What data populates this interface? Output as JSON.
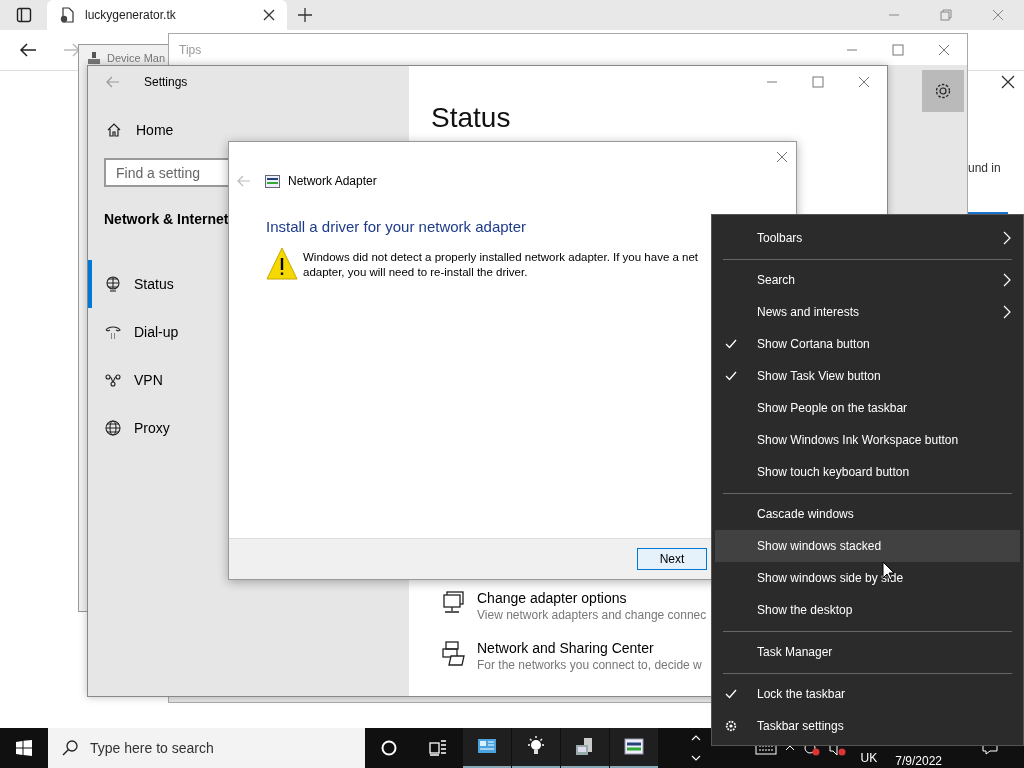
{
  "browser": {
    "tab_title": "luckygenerator.tk"
  },
  "device_manager": {
    "title": "Device Man"
  },
  "tips": {
    "title": "Tips"
  },
  "side_panel": {
    "text": "und in"
  },
  "settings": {
    "title": "Settings",
    "home": "Home",
    "search_placeholder": "Find a setting",
    "section": "Network & Internet",
    "nav": [
      {
        "label": "Status",
        "selected": true
      },
      {
        "label": "Dial-up",
        "selected": false
      },
      {
        "label": "VPN",
        "selected": false
      },
      {
        "label": "Proxy",
        "selected": false
      }
    ],
    "heading": "Status",
    "links": [
      {
        "title": "Change adapter options",
        "subtitle": "View network adapters and change connec"
      },
      {
        "title": "Network and Sharing Center",
        "subtitle": "For the networks you connect to, decide w"
      }
    ]
  },
  "dialog": {
    "title": "Network Adapter",
    "heading": "Install a driver for your network adapter",
    "message_lines": [
      "Windows did not detect a properly installed network adapter. If you have a net",
      "adapter, you will need to re-install the driver."
    ],
    "next_button": "Next"
  },
  "context_menu": {
    "items": [
      {
        "kind": "item",
        "label": "Toolbars",
        "submenu": true,
        "checked": false,
        "highlighted": false
      },
      {
        "kind": "separator"
      },
      {
        "kind": "item",
        "label": "Search",
        "submenu": true,
        "checked": false,
        "highlighted": false
      },
      {
        "kind": "item",
        "label": "News and interests",
        "submenu": true,
        "checked": false,
        "highlighted": false
      },
      {
        "kind": "item",
        "label": "Show Cortana button",
        "submenu": false,
        "checked": true,
        "highlighted": false
      },
      {
        "kind": "item",
        "label": "Show Task View button",
        "submenu": false,
        "checked": true,
        "highlighted": false
      },
      {
        "kind": "item",
        "label": "Show People on the taskbar",
        "submenu": false,
        "checked": false,
        "highlighted": false
      },
      {
        "kind": "item",
        "label": "Show Windows Ink Workspace button",
        "submenu": false,
        "checked": false,
        "highlighted": false
      },
      {
        "kind": "item",
        "label": "Show touch keyboard button",
        "submenu": false,
        "checked": false,
        "highlighted": false
      },
      {
        "kind": "separator"
      },
      {
        "kind": "item",
        "label": "Cascade windows",
        "submenu": false,
        "checked": false,
        "highlighted": false
      },
      {
        "kind": "item",
        "label": "Show windows stacked",
        "submenu": false,
        "checked": false,
        "highlighted": true
      },
      {
        "kind": "item",
        "label": "Show windows side by side",
        "submenu": false,
        "checked": false,
        "highlighted": false
      },
      {
        "kind": "item",
        "label": "Show the desktop",
        "submenu": false,
        "checked": false,
        "highlighted": false
      },
      {
        "kind": "separator"
      },
      {
        "kind": "item",
        "label": "Task Manager",
        "submenu": false,
        "checked": false,
        "highlighted": false
      },
      {
        "kind": "separator"
      },
      {
        "kind": "item",
        "label": "Lock the taskbar",
        "submenu": false,
        "checked": true,
        "highlighted": false
      },
      {
        "kind": "settings",
        "label": "Taskbar settings"
      }
    ]
  },
  "taskbar": {
    "search_placeholder": "Type here to search",
    "language": "UK",
    "date": "7/9/2022"
  }
}
